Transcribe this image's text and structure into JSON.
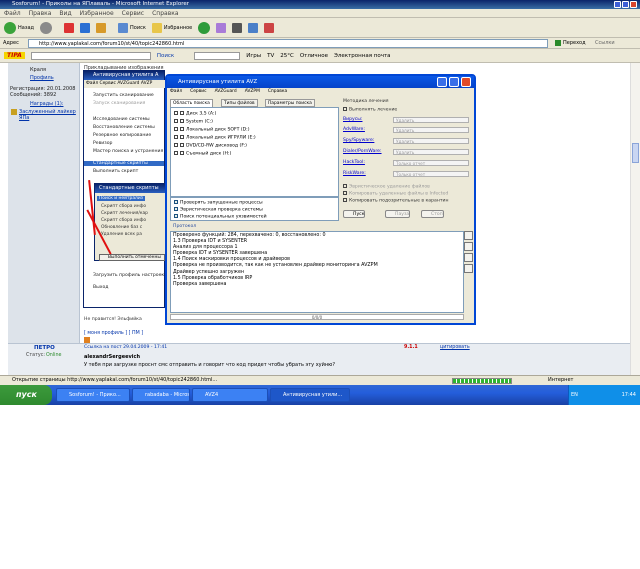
{
  "browser": {
    "title": "Sosforum! - Приколы на ЯПлаваль - Microsoft Internet Explorer",
    "menu": [
      "Файл",
      "Правка",
      "Вид",
      "Избранное",
      "Сервис",
      "Справка"
    ],
    "toolbar": {
      "back": "Назад",
      "search": "Поиск",
      "favorites": "Избранное"
    },
    "address_label": "Адрес",
    "url": "http://www.yaplakal.com/forum10/st/40/topic242860.html",
    "go": "Переход",
    "links": "Ссылки",
    "links_bar": {
      "brand": "TIPA",
      "search": "Поиск",
      "games": "Игры",
      "tv": "TV",
      "weather": "25°C",
      "excellent": "Отличное",
      "mail": "Электронная почта"
    },
    "status_text": "Открытие страницы http://www.yaplakal.com/forum10/st/40/topic242860.html...",
    "internet": "Интернет"
  },
  "forum": {
    "left_info": {
      "role": "Краля",
      "profile": "Профиль",
      "registered": "Регистрация: 20.01.2008",
      "messages": "Сообщений: 3892",
      "awards": "Награды (1):",
      "award_text": "Заслуженный лайкер ЯПа"
    },
    "top_header": "Прикладывание изображения",
    "thanks": "Не правится! Эльфийка",
    "profile_pm": "[ моня профиль ] [ ПМ ]",
    "post": {
      "user": "ПЕТРО",
      "status_label": "Статус:",
      "status": "Online",
      "link_info": "Ссылка на пост 29.04.2009 - 17:41",
      "num": "9.1.1",
      "quote": "цитировать",
      "author": "alexandrSergeevich",
      "text": "У тебя при загрузке проснт смс отправить и говорит что код придет чтобы убрать эту хуйню?"
    }
  },
  "taskbar": {
    "start": "пуск",
    "tasks": [
      "Sosforum! - Прико...",
      "rabadaba - Microsoft...",
      "AVZ4",
      "Антивирусная утили..."
    ],
    "lang": "EN",
    "time": "17:44"
  },
  "avz_back": {
    "title": "Антивирусная утилита A",
    "menu": "Файл Сервис AVZGuard AVZP",
    "items": [
      "Запустить сканирование",
      "Запуск сканирования",
      "Исследование системы",
      "Восстановление системы",
      "Резервное копирование",
      "Ревизор",
      "Мастер поиска и устранения пр",
      "Стандартные скрипты",
      "Выполнить скрипт",
      "Загрузить профиль настроек",
      "Выход"
    ],
    "dialog_title": "Стандартные скрипты",
    "dialog_items": [
      "Поиск и нейтрализ",
      "Скрипт сбора инфо",
      "Скрипт лечения/кар",
      "Скрипт сбора инфо",
      "Обновление баз с",
      "Удаление всех ра"
    ],
    "exec_button": "Выполнить отмеченны"
  },
  "avz": {
    "title": "Антивирусная утилита AVZ",
    "menu": [
      "Файл",
      "Сервис",
      "AVZGuard",
      "AVZPM",
      "Справка"
    ],
    "tabs": [
      "Область поиска",
      "Типы файлов",
      "Параметры поиска"
    ],
    "drives": [
      "Диск 3,5 (A:)",
      "System (C:)",
      "Локальный диск SOFT (D:)",
      "Локальный диск ИГРУЛИ (E:)",
      "DVD/CD-RW дисковод (F:)",
      "Съемный диск (H:)"
    ],
    "checks": [
      "Проверять запущенные процессы",
      "Эвристическая проверка системы",
      "Поиск потенциальных уязвимостей"
    ],
    "method_title": "Методика лечения",
    "do_heal": "Выполнять лечение",
    "method_rows": [
      {
        "label": "Вирусы:",
        "value": "Удалить"
      },
      {
        "label": "AdvWare:",
        "value": "Удалить"
      },
      {
        "label": "Spy/Spyware:",
        "value": "Удалить"
      },
      {
        "label": "Dialer/PornWare:",
        "value": "Удалить"
      },
      {
        "label": "HackTool:",
        "value": "Только отчет"
      },
      {
        "label": "RiskWare:",
        "value": "Только отчет"
      }
    ],
    "heur_delete": "Эвристическое удаление файлов",
    "copy_deleted": "Копировать удаленные файлы в Infected",
    "copy_suspicious": "Копировать подозрительные в карантин",
    "buttons": {
      "start": "Пуск",
      "pause": "Пауза",
      "stop": "Стоп"
    },
    "protocol_label": "Протокол",
    "log": [
      "Проверено функций: 284, перехвачено: 0, восстановлено: 0",
      "1.3 Проверка IDT и SYSENTER",
      "Анализ для процессора 1",
      "Проверка IDT и SYSENTER завершена",
      "1.4 Поиск маскировки процессов и драйверов",
      "Проверка не производится, так как не установлен драйвер мониторинга AVZPM",
      "Драйвер успешно загружен",
      "1.5 Проверка обработчиков IRP",
      "Проверка завершена"
    ],
    "progress": "0/0/0"
  }
}
